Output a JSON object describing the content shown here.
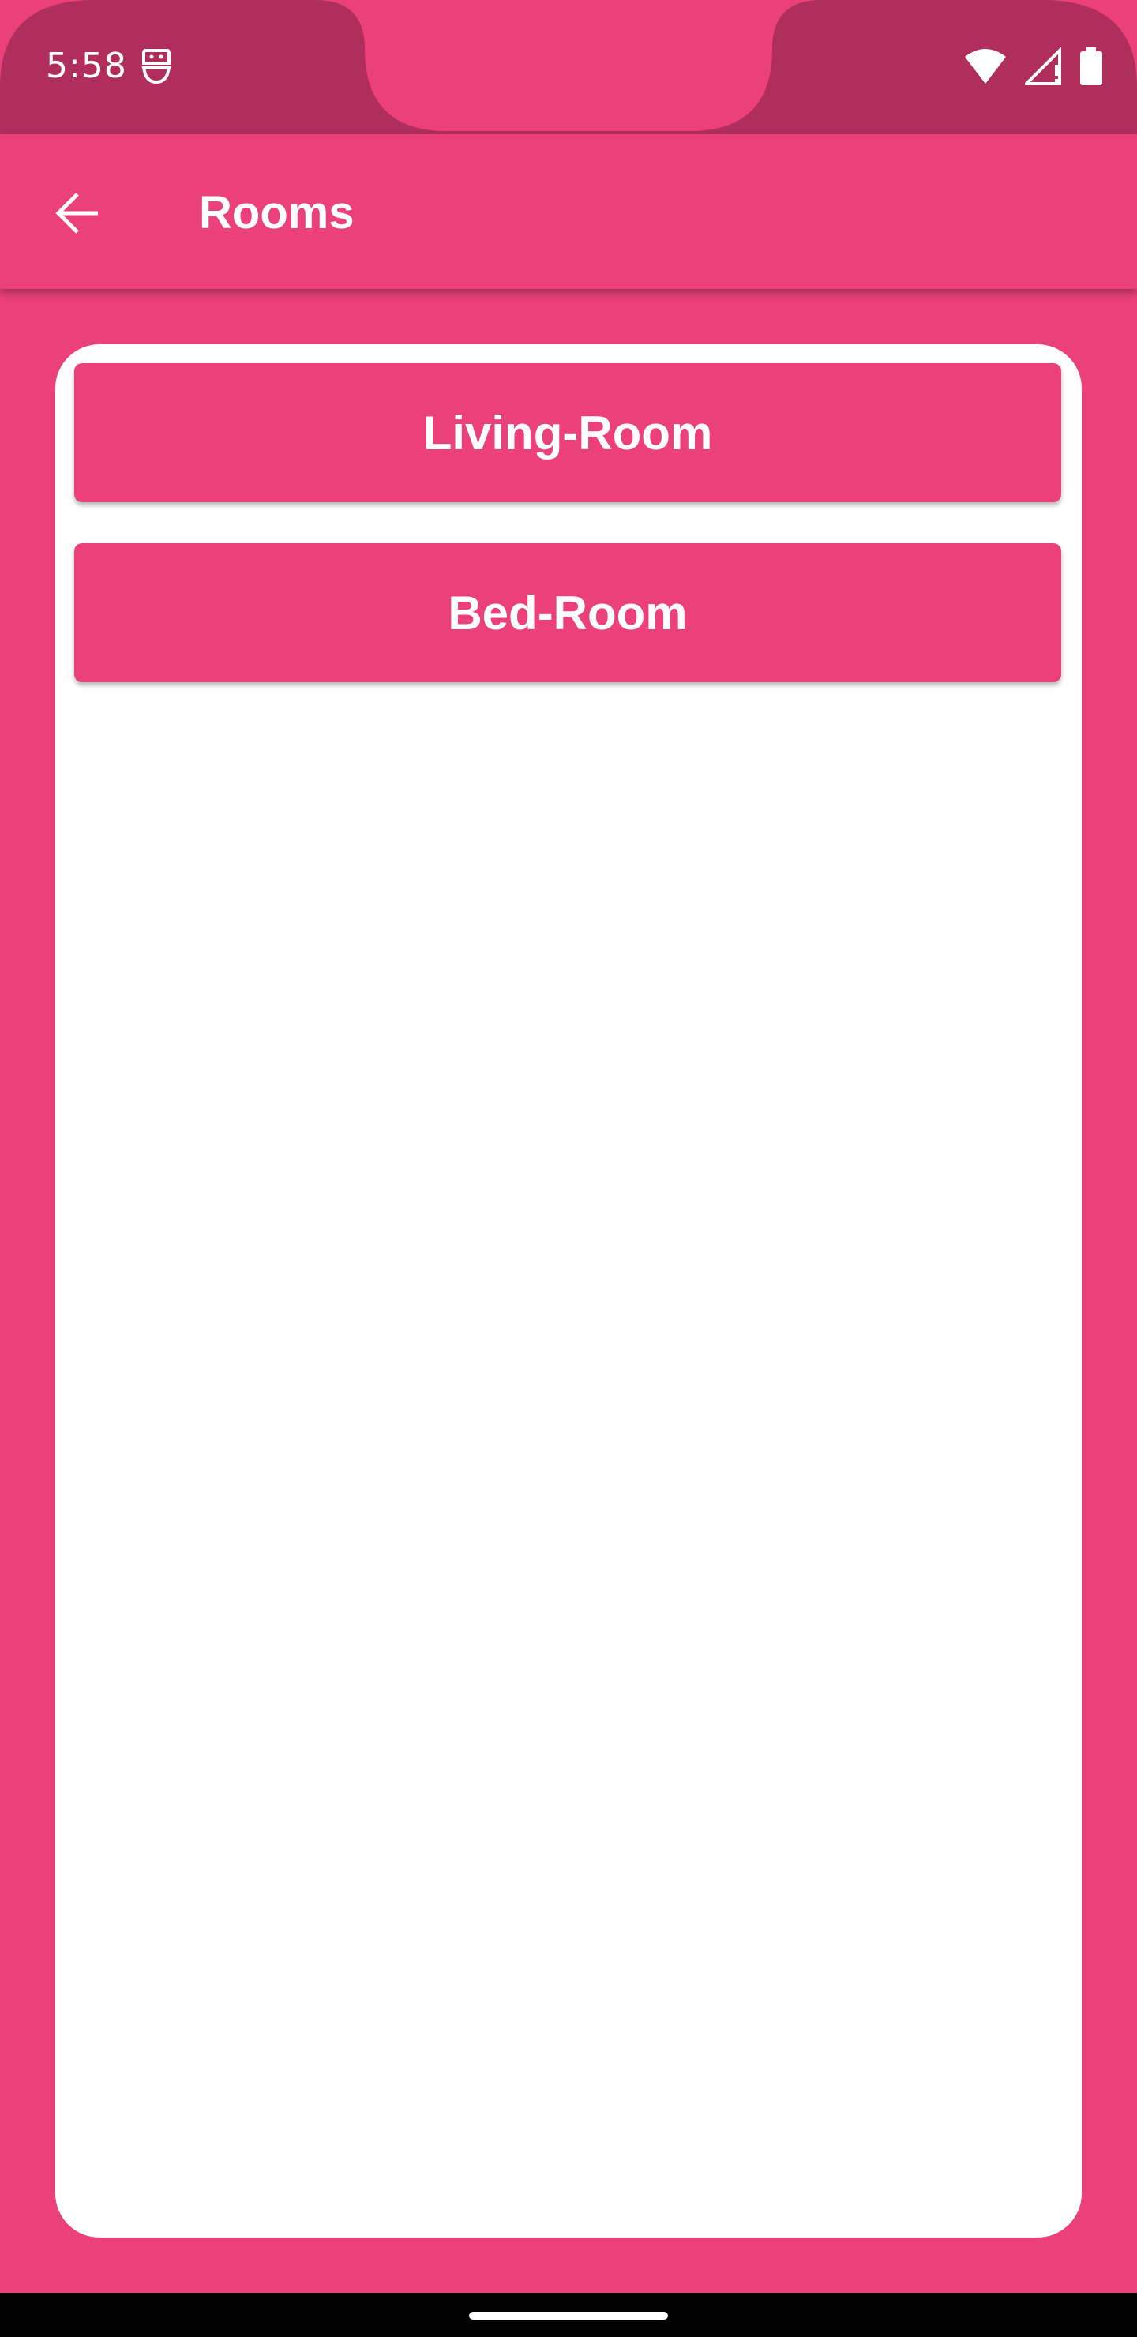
{
  "status_bar": {
    "time": "5:58",
    "left_icon": "android-debug-icon",
    "icons": [
      "wifi-icon",
      "signal-icon",
      "battery-icon"
    ],
    "color": "#B02E5C"
  },
  "app_bar": {
    "title": "Rooms",
    "back_icon": "arrow-back-icon",
    "color": "#EC407A"
  },
  "rooms": [
    {
      "label": "Living-Room"
    },
    {
      "label": "Bed-Room"
    }
  ],
  "colors": {
    "primary": "#EC407A",
    "status_bar": "#B02E5C",
    "card": "#FFFFFF",
    "text_on_primary": "#FFFFFF"
  }
}
